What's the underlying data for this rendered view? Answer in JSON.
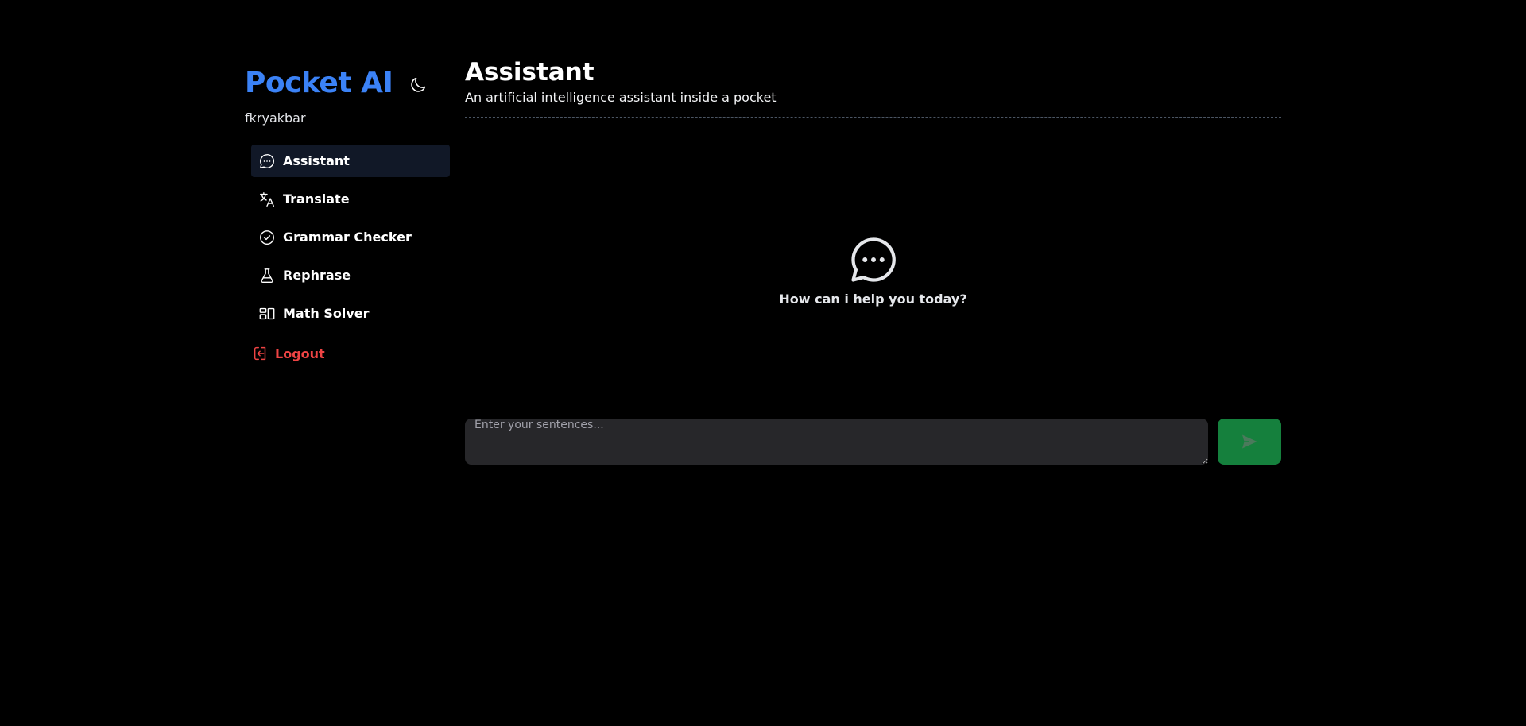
{
  "brand": {
    "name": "Pocket AI",
    "color": "#3b82f6"
  },
  "theme_toggle": {
    "icon": "moon-icon"
  },
  "user": {
    "username": "fkryakbar"
  },
  "nav": {
    "items": [
      {
        "label": "Assistant",
        "icon": "chat-bubble-icon",
        "active": true
      },
      {
        "label": "Translate",
        "icon": "translate-icon",
        "active": false
      },
      {
        "label": "Grammar Checker",
        "icon": "check-circle-icon",
        "active": false
      },
      {
        "label": "Rephrase",
        "icon": "beaker-icon",
        "active": false
      },
      {
        "label": "Math Solver",
        "icon": "layout-blocks-icon",
        "active": false
      }
    ],
    "logout": {
      "label": "Logout",
      "icon": "logout-icon",
      "color": "#ef4444"
    }
  },
  "header": {
    "title": "Assistant",
    "subtitle": "An artificial intelligence assistant inside a pocket"
  },
  "empty_state": {
    "icon": "chat-bubble-icon",
    "text": "How can i help you today?"
  },
  "composer": {
    "placeholder": "Enter your sentences...",
    "value": "",
    "send_icon": "send-icon",
    "send_color": "#15803d"
  }
}
